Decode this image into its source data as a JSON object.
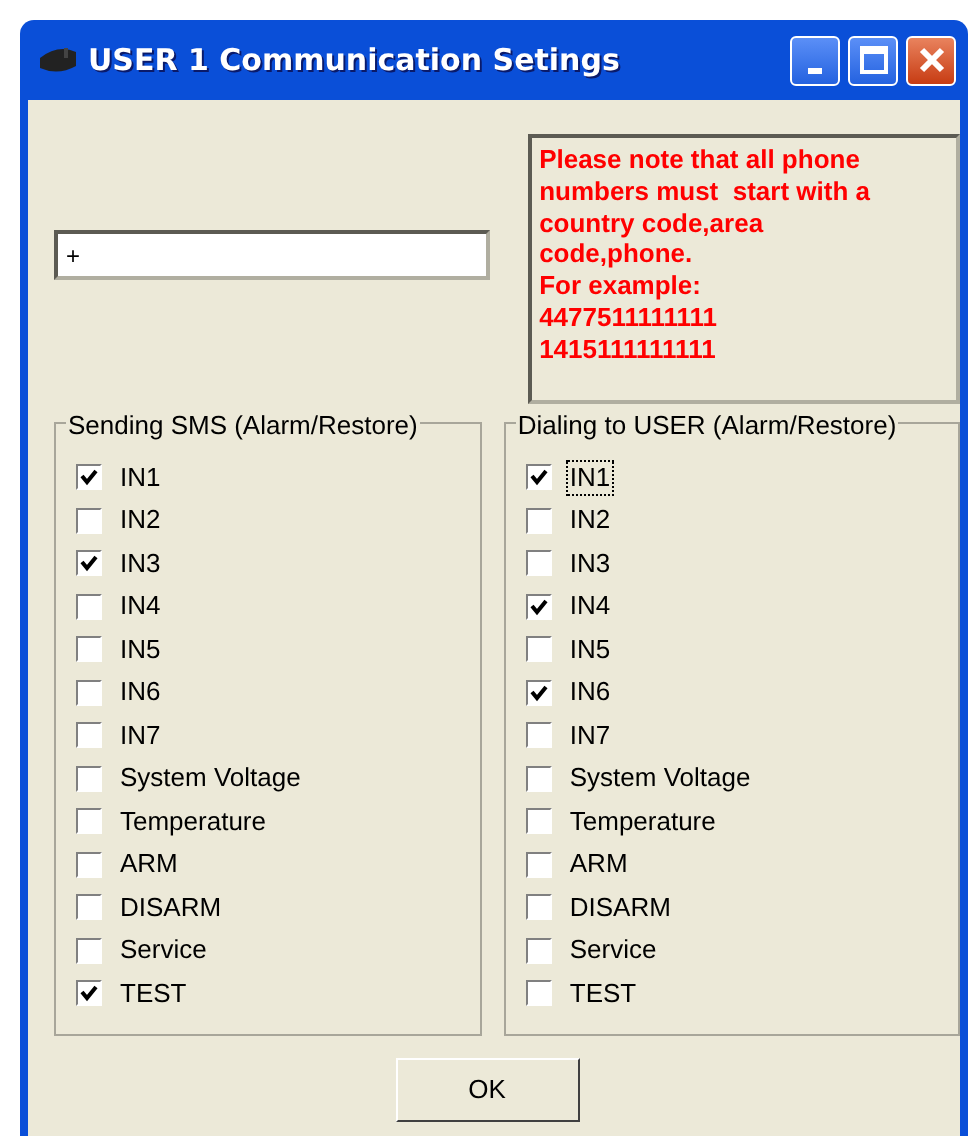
{
  "window": {
    "title": "USER 1 Communication Setings"
  },
  "phone_field": {
    "value": "+"
  },
  "note": {
    "lines": [
      "Please note that all phone",
      "numbers must  start with a",
      "country code,area",
      "code,phone.",
      "For example:",
      "4477511111111",
      "1415111111111"
    ]
  },
  "groups": [
    {
      "title": "Sending SMS (Alarm/Restore)",
      "items": [
        {
          "label": "IN1",
          "checked": true,
          "focused": false
        },
        {
          "label": "IN2",
          "checked": false,
          "focused": false
        },
        {
          "label": "IN3",
          "checked": true,
          "focused": false
        },
        {
          "label": "IN4",
          "checked": false,
          "focused": false
        },
        {
          "label": "IN5",
          "checked": false,
          "focused": false
        },
        {
          "label": "IN6",
          "checked": false,
          "focused": false
        },
        {
          "label": "IN7",
          "checked": false,
          "focused": false
        },
        {
          "label": "System Voltage",
          "checked": false,
          "focused": false
        },
        {
          "label": "Temperature",
          "checked": false,
          "focused": false
        },
        {
          "label": "ARM",
          "checked": false,
          "focused": false
        },
        {
          "label": "DISARM",
          "checked": false,
          "focused": false
        },
        {
          "label": "Service",
          "checked": false,
          "focused": false
        },
        {
          "label": "TEST",
          "checked": true,
          "focused": false
        }
      ]
    },
    {
      "title": "Dialing to USER (Alarm/Restore)",
      "items": [
        {
          "label": "IN1",
          "checked": true,
          "focused": true
        },
        {
          "label": "IN2",
          "checked": false,
          "focused": false
        },
        {
          "label": "IN3",
          "checked": false,
          "focused": false
        },
        {
          "label": "IN4",
          "checked": true,
          "focused": false
        },
        {
          "label": "IN5",
          "checked": false,
          "focused": false
        },
        {
          "label": "IN6",
          "checked": true,
          "focused": false
        },
        {
          "label": "IN7",
          "checked": false,
          "focused": false
        },
        {
          "label": "System Voltage",
          "checked": false,
          "focused": false
        },
        {
          "label": "Temperature",
          "checked": false,
          "focused": false
        },
        {
          "label": "ARM",
          "checked": false,
          "focused": false
        },
        {
          "label": "DISARM",
          "checked": false,
          "focused": false
        },
        {
          "label": "Service",
          "checked": false,
          "focused": false
        },
        {
          "label": "TEST",
          "checked": false,
          "focused": false
        }
      ]
    }
  ],
  "buttons": [
    {
      "label": "OK"
    }
  ]
}
